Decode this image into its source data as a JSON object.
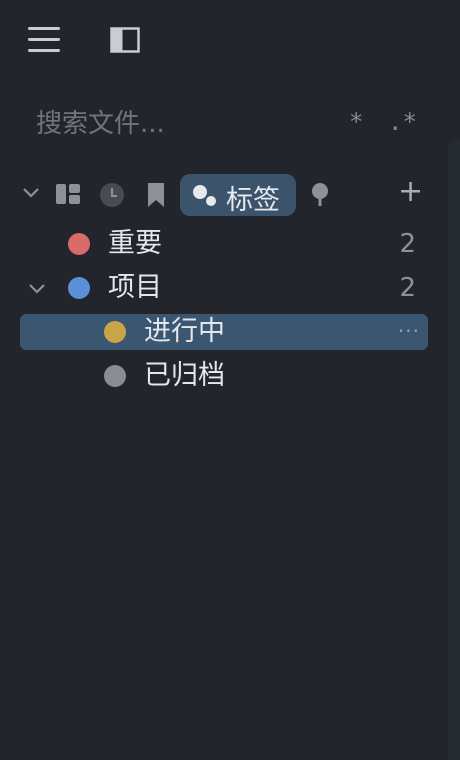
{
  "search": {
    "placeholder": "搜索文件...",
    "opt_glob": "*",
    "opt_regex": ".*"
  },
  "tabs": {
    "icons": [
      "layout-icon",
      "clock-icon",
      "bookmark-icon",
      "tags-icon",
      "pin-icon",
      "plus-icon"
    ],
    "active_label": "标签",
    "add_label": "+"
  },
  "tree": [
    {
      "label": "重要",
      "count": "2",
      "color": "#d96b6b",
      "level": 0,
      "expandable": false
    },
    {
      "label": "项目",
      "count": "2",
      "color": "#5b8fd6",
      "level": 0,
      "expandable": true,
      "expanded": true
    },
    {
      "label": "进行中",
      "count": "",
      "color": "#c9a54a",
      "level": 1,
      "selected": true,
      "more": "···"
    },
    {
      "label": "已归档",
      "count": "",
      "color": "#8a8d95",
      "level": 1
    }
  ],
  "colors": {
    "background": "#22252b",
    "selected_row": "#3a5670",
    "active_tab": "#3b546b"
  }
}
